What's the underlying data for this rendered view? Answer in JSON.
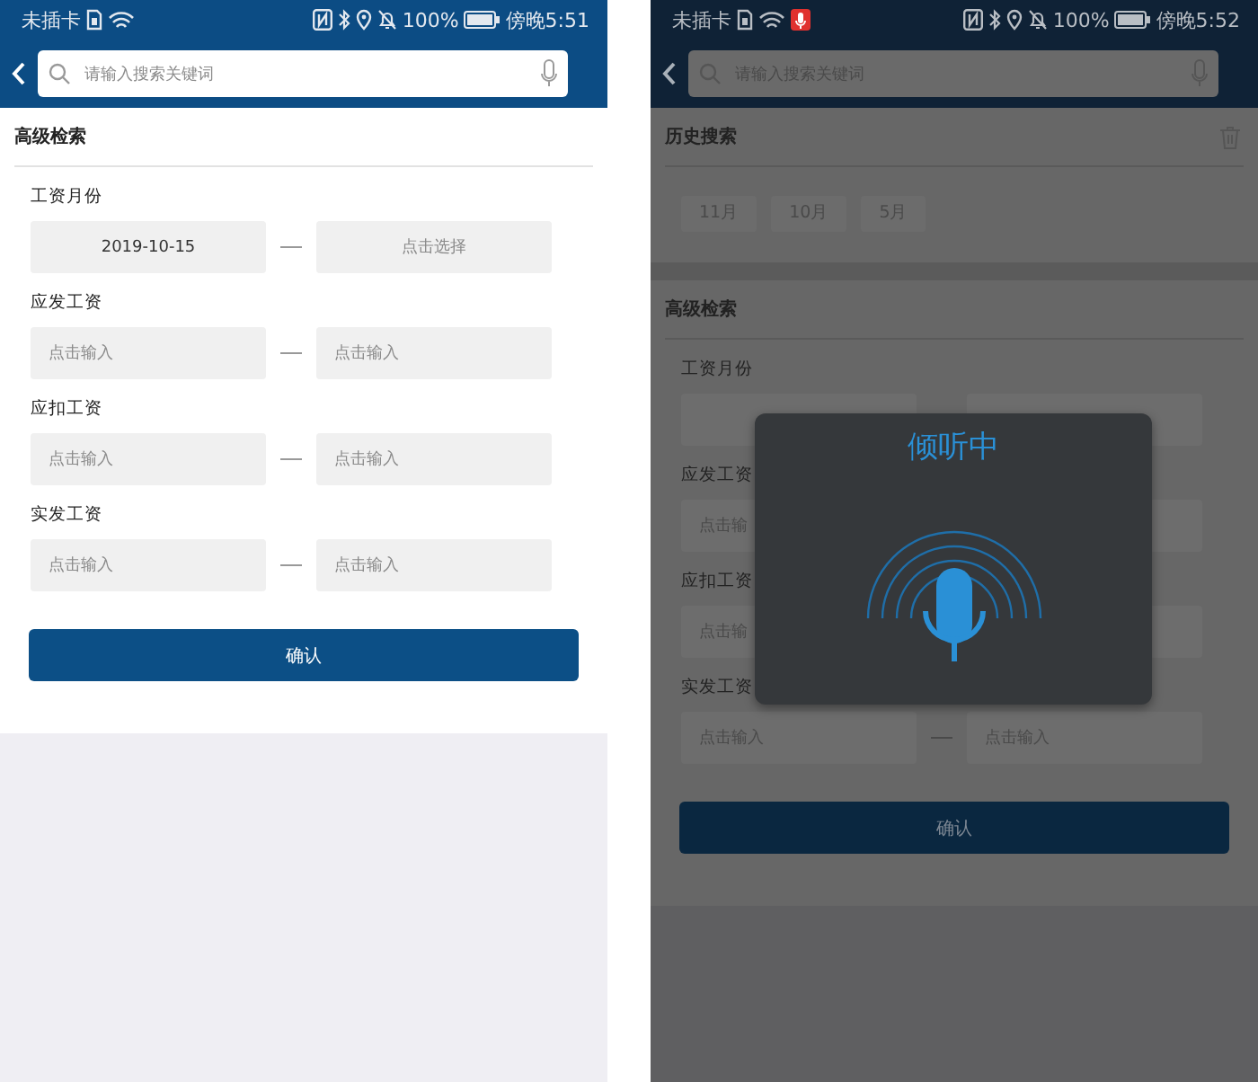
{
  "screens": [
    {
      "dimmed": false,
      "status": {
        "carrier": "未插卡",
        "recording": false,
        "battery": "100%",
        "time": "傍晚5:51"
      },
      "search": {
        "placeholder": "请输入搜索关键词"
      },
      "advanced": {
        "title": "高级检索",
        "fields": [
          {
            "label": "工资月份",
            "kind": "date",
            "from": {
              "value": "2019-10-15"
            },
            "to": {
              "placeholder": "点击选择"
            }
          },
          {
            "label": "应发工资",
            "kind": "number",
            "from": {
              "placeholder": "点击输入"
            },
            "to": {
              "placeholder": "点击输入"
            }
          },
          {
            "label": "应扣工资",
            "kind": "number",
            "from": {
              "placeholder": "点击输入"
            },
            "to": {
              "placeholder": "点击输入"
            }
          },
          {
            "label": "实发工资",
            "kind": "number",
            "from": {
              "placeholder": "点击输入"
            },
            "to": {
              "placeholder": "点击输入"
            }
          }
        ]
      },
      "confirm": "确认"
    },
    {
      "dimmed": true,
      "status": {
        "carrier": "未插卡",
        "recording": true,
        "battery": "100%",
        "time": "傍晚5:52"
      },
      "search": {
        "placeholder": "请输入搜索关键词"
      },
      "history": {
        "title": "历史搜索",
        "items": [
          "11月",
          "10月",
          "5月"
        ]
      },
      "advanced": {
        "title": "高级检索",
        "fields": [
          {
            "label": "工资月份",
            "kind": "date"
          },
          {
            "label": "应发工资",
            "kind": "number",
            "from": {
              "placeholder": "点击输"
            }
          },
          {
            "label": "应扣工资",
            "kind": "number",
            "from": {
              "placeholder": "点击输"
            }
          },
          {
            "label": "实发工资",
            "kind": "number",
            "from": {
              "placeholder": "点击输入"
            },
            "to": {
              "placeholder": "点击输入"
            }
          }
        ]
      },
      "confirm": "确认",
      "voice_dialog": {
        "title": "倾听中"
      }
    }
  ]
}
